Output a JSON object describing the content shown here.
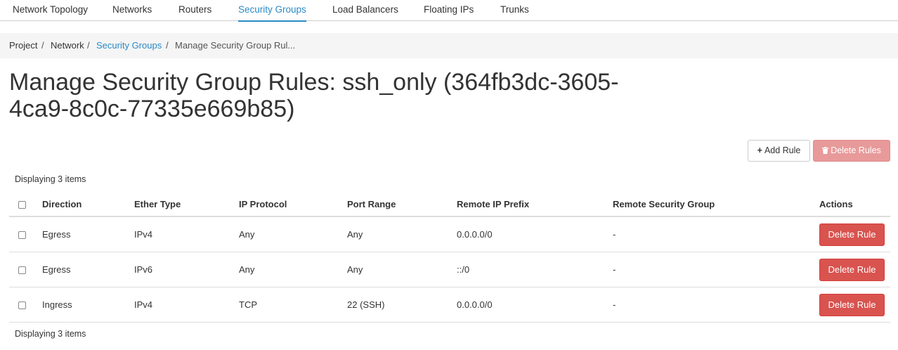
{
  "tabs": [
    {
      "label": "Network Topology",
      "active": false
    },
    {
      "label": "Networks",
      "active": false
    },
    {
      "label": "Routers",
      "active": false
    },
    {
      "label": "Security Groups",
      "active": true
    },
    {
      "label": "Load Balancers",
      "active": false
    },
    {
      "label": "Floating IPs",
      "active": false
    },
    {
      "label": "Trunks",
      "active": false
    }
  ],
  "breadcrumb": {
    "items": [
      "Project",
      "Network",
      "Security Groups",
      "Manage Security Group Rul..."
    ],
    "separator": "/"
  },
  "page": {
    "title": "Manage Security Group Rules: ssh_only (364fb3dc-3605-4ca9-8c0c-77335e669b85)"
  },
  "actions": {
    "add_rule": {
      "icon": "plus-icon",
      "label": "Add Rule"
    },
    "delete_rules": {
      "icon": "trash-icon",
      "label": "Delete Rules",
      "disabled": true
    }
  },
  "table": {
    "count_top": "Displaying 3 items",
    "count_bottom": "Displaying 3 items",
    "columns": [
      "Direction",
      "Ether Type",
      "IP Protocol",
      "Port Range",
      "Remote IP Prefix",
      "Remote Security Group",
      "Actions"
    ],
    "rows": [
      {
        "direction": "Egress",
        "ether_type": "IPv4",
        "ip_protocol": "Any",
        "port_range": "Any",
        "remote_ip_prefix": "0.0.0.0/0",
        "remote_security_group": "-",
        "action": "Delete Rule"
      },
      {
        "direction": "Egress",
        "ether_type": "IPv6",
        "ip_protocol": "Any",
        "port_range": "Any",
        "remote_ip_prefix": "::/0",
        "remote_security_group": "-",
        "action": "Delete Rule"
      },
      {
        "direction": "Ingress",
        "ether_type": "IPv4",
        "ip_protocol": "TCP",
        "port_range": "22 (SSH)",
        "remote_ip_prefix": "0.0.0.0/0",
        "remote_security_group": "-",
        "action": "Delete Rule"
      }
    ]
  },
  "colors": {
    "accent": "#2a8ac7",
    "danger": "#d9534f",
    "danger_disabled": "#e89a9a"
  }
}
